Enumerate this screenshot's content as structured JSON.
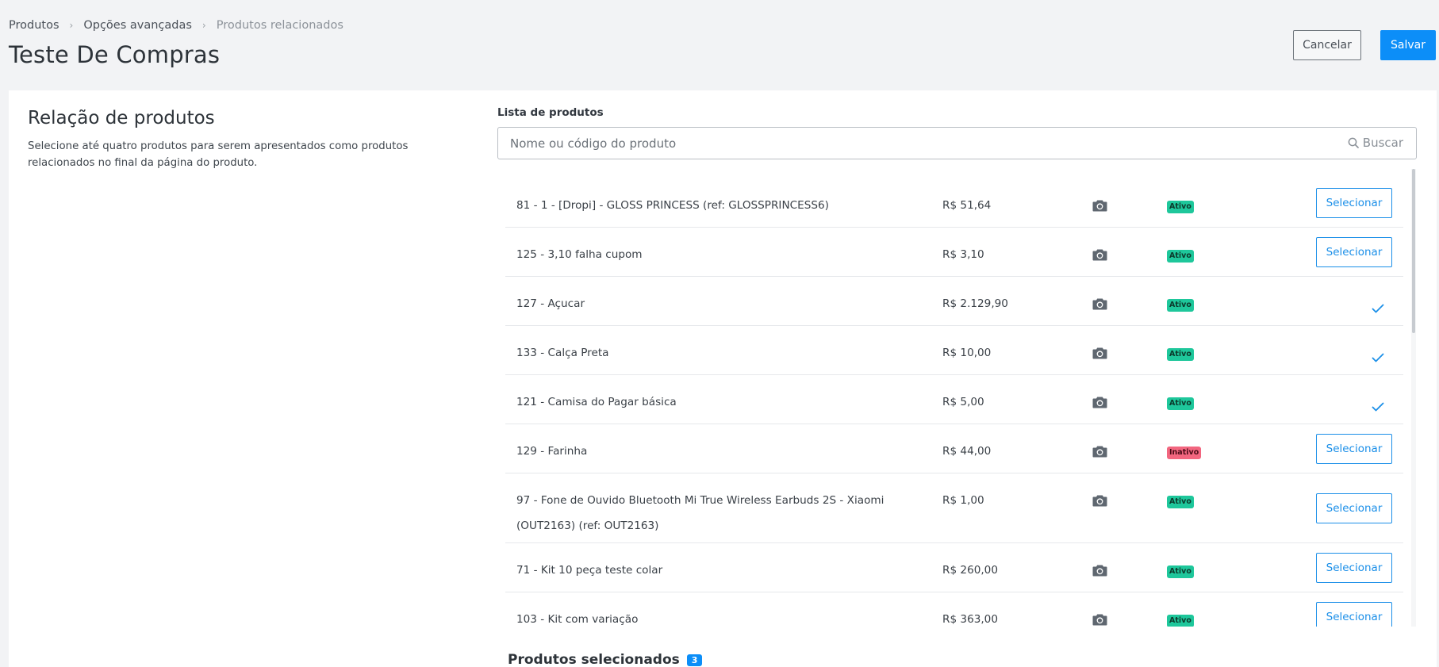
{
  "breadcrumb": {
    "items": [
      "Produtos",
      "Opções avançadas",
      "Produtos relacionados"
    ]
  },
  "header": {
    "title": "Teste De Compras",
    "cancel_label": "Cancelar",
    "save_label": "Salvar"
  },
  "left_panel": {
    "title": "Relação de produtos",
    "description": "Selecione até quatro produtos para serem apresentados como produtos relacionados no final da página do produto."
  },
  "product_list": {
    "label": "Lista de produtos",
    "search_placeholder": "Nome ou código do produto",
    "search_button_label": "Buscar",
    "select_label": "Selecionar",
    "rows": [
      {
        "name": "81 - 1 - [Dropi] - GLOSS PRINCESS (ref: GLOSSPRINCESS6)",
        "price": "R$ 51,64",
        "status": "Ativo",
        "selected": false
      },
      {
        "name": "125 - 3,10 falha cupom",
        "price": "R$ 3,10",
        "status": "Ativo",
        "selected": false
      },
      {
        "name": "127 - Açucar",
        "price": "R$ 2.129,90",
        "status": "Ativo",
        "selected": true
      },
      {
        "name": "133 - Calça Preta",
        "price": "R$ 10,00",
        "status": "Ativo",
        "selected": true
      },
      {
        "name": "121 - Camisa do Pagar básica",
        "price": "R$ 5,00",
        "status": "Ativo",
        "selected": true
      },
      {
        "name": "129 - Farinha",
        "price": "R$ 44,00",
        "status": "Inativo",
        "selected": false
      },
      {
        "name": "97 - Fone de Ouvido Bluetooth Mi True Wireless Earbuds 2S - Xiaomi (OUT2163) (ref: OUT2163)",
        "price": "R$ 1,00",
        "status": "Ativo",
        "selected": false
      },
      {
        "name": "71 - Kit 10 peça teste colar",
        "price": "R$ 260,00",
        "status": "Ativo",
        "selected": false
      },
      {
        "name": "103 - Kit com variação",
        "price": "R$ 363,00",
        "status": "Ativo",
        "selected": false
      }
    ]
  },
  "selected_section": {
    "title": "Produtos selecionados",
    "count": "3"
  },
  "colors": {
    "primary": "#0c8ef8",
    "active_badge": "#1ec79b",
    "inactive_badge": "#f2667f"
  }
}
